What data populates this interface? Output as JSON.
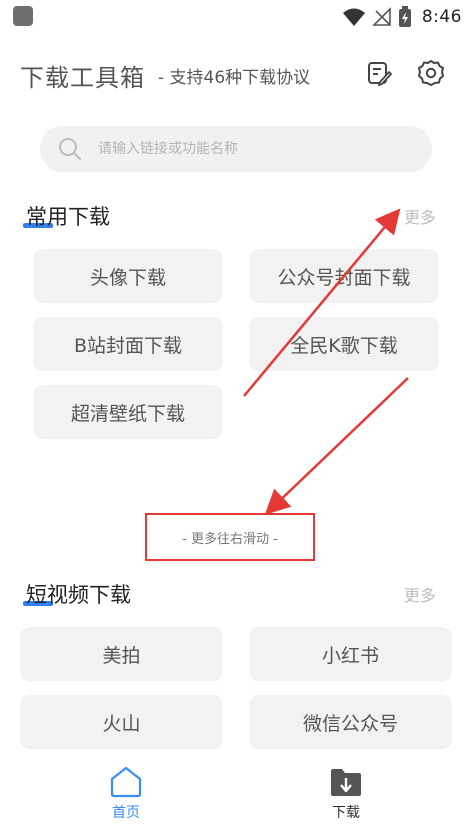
{
  "status_bar": {
    "time": "8:46"
  },
  "header": {
    "title": "下载工具箱",
    "subtitle": "- 支持46种下载协议"
  },
  "search": {
    "placeholder": "请输入链接或功能名称"
  },
  "sections": {
    "common": {
      "title": "常用下载",
      "more": "更多",
      "items": [
        "头像下载",
        "公众号封面下载",
        "B站封面下载",
        "全民K歌下载",
        "超清壁纸下载"
      ]
    },
    "short_video": {
      "title": "短视频下载",
      "more": "更多",
      "items": [
        "美拍",
        "小红书",
        "火山",
        "微信公众号"
      ]
    }
  },
  "hint": "- 更多往右滑动 -",
  "bottom_nav": {
    "home": "首页",
    "download": "下载"
  },
  "colors": {
    "accent": "#3b8df5",
    "annotation": "#e53935"
  }
}
